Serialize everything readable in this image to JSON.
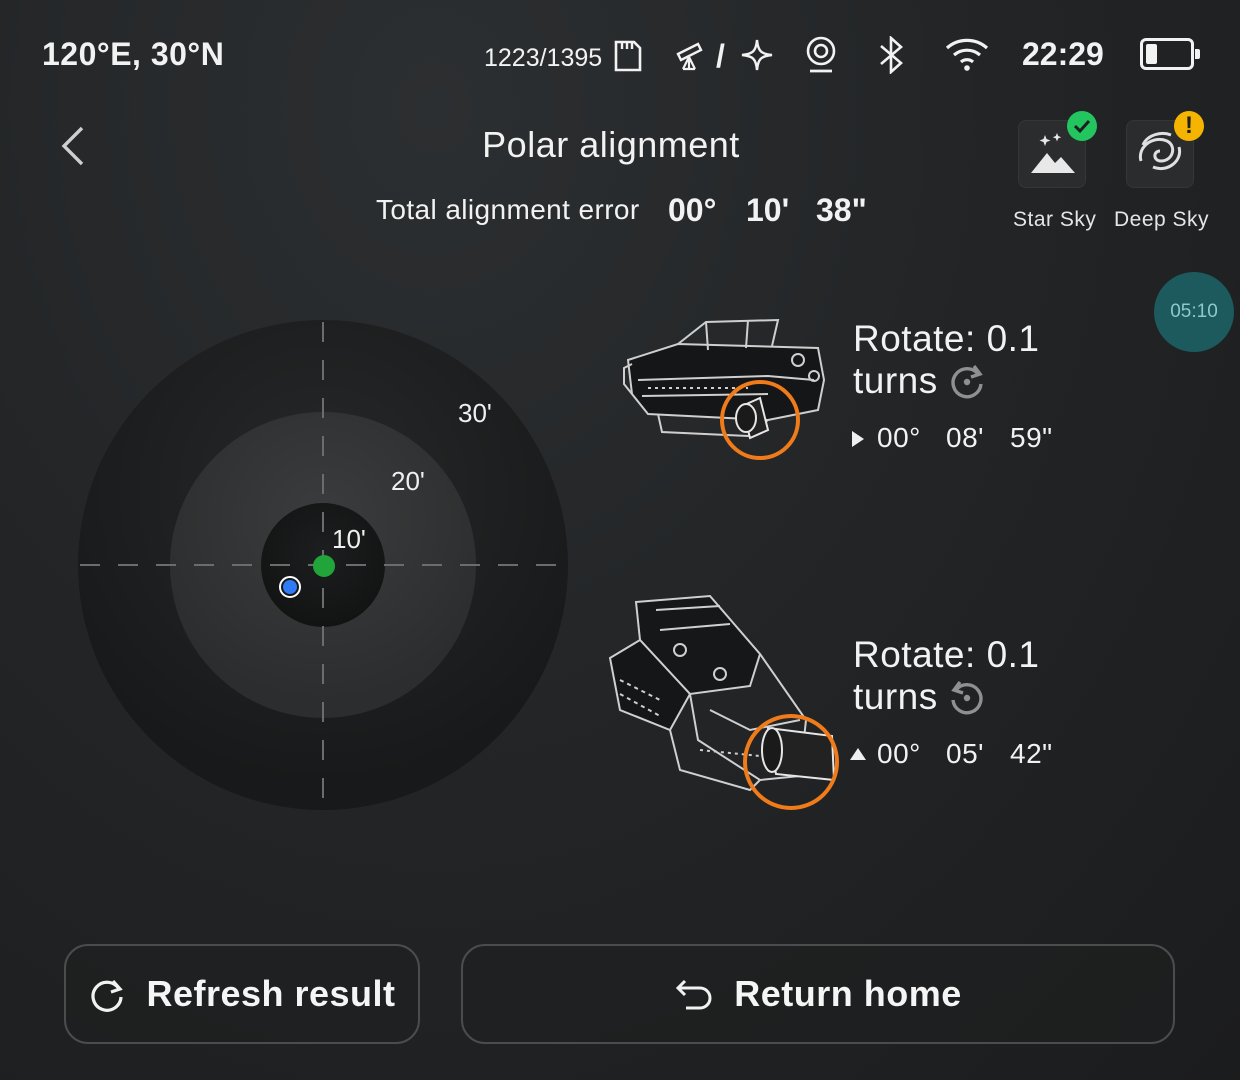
{
  "status": {
    "location": "120°E, 30°N",
    "storage": "1223/1395",
    "mount_mode_separator": "/",
    "time": "22:29",
    "battery_level": 0.25
  },
  "header": {
    "title": "Polar alignment",
    "error_label": "Total alignment error",
    "error_deg": "00°",
    "error_min": "10'",
    "error_sec": "38\""
  },
  "modes": [
    {
      "label": "Star Sky",
      "icon": "star-sky-icon",
      "status": "ok",
      "status_color": "#22c55e"
    },
    {
      "label": "Deep Sky",
      "icon": "galaxy-icon",
      "status": "warning",
      "status_color": "#f5b400"
    }
  ],
  "timer": "05:10",
  "target": {
    "rings": [
      "10'",
      "20'",
      "30'"
    ],
    "current_color": "#21a43a",
    "target_color": "#2f7bf5"
  },
  "adjustments": [
    {
      "text": "Rotate: 0.1",
      "text2": "turns",
      "direction": "clockwise",
      "indicator": "right-triangle",
      "deg": "00°",
      "min": "08'",
      "sec": "59\""
    },
    {
      "text": "Rotate: 0.1",
      "text2": "turns",
      "direction": "counter-clockwise",
      "indicator": "up-triangle",
      "deg": "00°",
      "min": "05'",
      "sec": "42\""
    }
  ],
  "accent": "#f07b1a",
  "buttons": {
    "refresh": "Refresh result",
    "home": "Return home"
  }
}
